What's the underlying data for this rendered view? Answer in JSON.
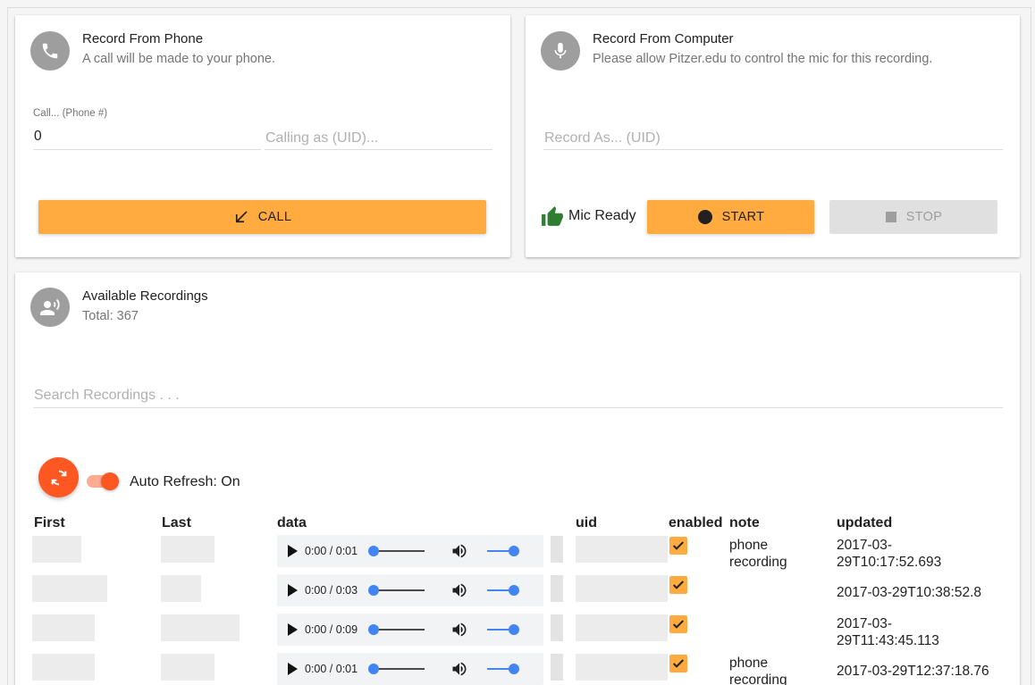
{
  "phone_card": {
    "title": "Record From Phone",
    "subtitle": "A call will be made to your phone.",
    "phone_label": "Call... (Phone #)",
    "phone_value": "0",
    "uid_placeholder": "Calling as (UID)...",
    "call_label": "CALL",
    "icon": "phone-icon"
  },
  "computer_card": {
    "title": "Record From Computer",
    "subtitle": "Please allow Pitzer.edu to control the mic for this recording.",
    "uid_placeholder": "Record As... (UID)",
    "mic_status": "Mic Ready",
    "start_label": "START",
    "stop_label": "STOP",
    "icon": "mic-icon"
  },
  "recordings": {
    "title": "Available Recordings",
    "total": "Total: 367",
    "search_placeholder": "Search Recordings . . .",
    "auto_refresh_label": "Auto Refresh: On",
    "columns": [
      "First",
      "Last",
      "data",
      "uid",
      "enabled",
      "note",
      "updated"
    ],
    "rows": [
      {
        "time": "0:00 / 0:01",
        "enabled": true,
        "note": "phone recording",
        "updated": "2017-03-29T10:17:52.693"
      },
      {
        "time": "0:00 / 0:03",
        "enabled": true,
        "note": "",
        "updated": "2017-03-29T10:38:52.8"
      },
      {
        "time": "0:00 / 0:09",
        "enabled": true,
        "note": "",
        "updated": "2017-03-29T11:43:45.113"
      },
      {
        "time": "0:00 / 0:01",
        "enabled": true,
        "note": "phone recording",
        "updated": "2017-03-29T12:37:18.76"
      }
    ]
  },
  "colors": {
    "accent": "#ffab40",
    "refresh": "#ff5722",
    "thumb_green": "#2e7d32",
    "audio_blue": "#4285f4"
  }
}
